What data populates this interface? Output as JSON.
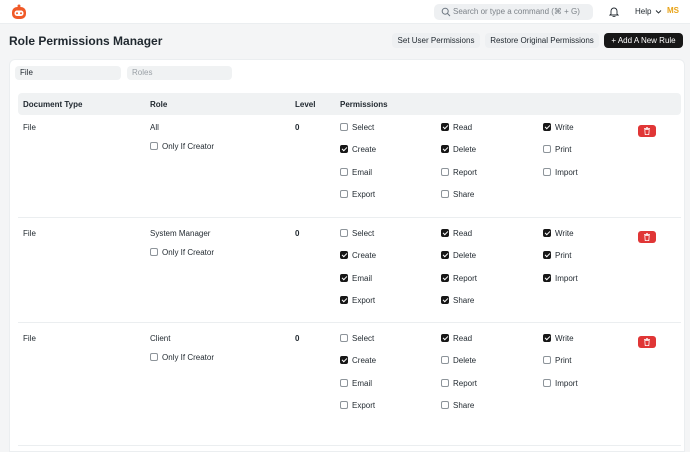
{
  "navbar": {
    "search_placeholder": "Search or type a command (⌘ + G)",
    "help_label": "Help",
    "avatar_initials": "MS"
  },
  "page": {
    "title": "Role Permissions Manager",
    "set_user_permissions": "Set User Permissions",
    "restore_original_permissions": "Restore Original Permissions",
    "add_new_rule": "+ Add A New Rule"
  },
  "filters": {
    "document_type_value": "File",
    "roles_placeholder": "Roles"
  },
  "table": {
    "headers": {
      "document_type": "Document Type",
      "role": "Role",
      "level": "Level",
      "permissions": "Permissions"
    },
    "only_if_creator_label": "Only If Creator",
    "rows": [
      {
        "document_type": "File",
        "role": "All",
        "level": "0",
        "only_if_creator": false,
        "permissions": [
          {
            "label": "Select",
            "checked": false
          },
          {
            "label": "Read",
            "checked": true
          },
          {
            "label": "Write",
            "checked": true
          },
          {
            "label": "Create",
            "checked": true
          },
          {
            "label": "Delete",
            "checked": true
          },
          {
            "label": "Print",
            "checked": false
          },
          {
            "label": "Email",
            "checked": false
          },
          {
            "label": "Report",
            "checked": false
          },
          {
            "label": "Import",
            "checked": false
          },
          {
            "label": "Export",
            "checked": false
          },
          {
            "label": "Share",
            "checked": false
          }
        ]
      },
      {
        "document_type": "File",
        "role": "System Manager",
        "level": "0",
        "only_if_creator": false,
        "permissions": [
          {
            "label": "Select",
            "checked": false
          },
          {
            "label": "Read",
            "checked": true
          },
          {
            "label": "Write",
            "checked": true
          },
          {
            "label": "Create",
            "checked": true
          },
          {
            "label": "Delete",
            "checked": true
          },
          {
            "label": "Print",
            "checked": true
          },
          {
            "label": "Email",
            "checked": true
          },
          {
            "label": "Report",
            "checked": true
          },
          {
            "label": "Import",
            "checked": true
          },
          {
            "label": "Export",
            "checked": true
          },
          {
            "label": "Share",
            "checked": true
          }
        ]
      },
      {
        "document_type": "File",
        "role": "Client",
        "level": "0",
        "only_if_creator": false,
        "permissions": [
          {
            "label": "Select",
            "checked": false
          },
          {
            "label": "Read",
            "checked": true
          },
          {
            "label": "Write",
            "checked": true
          },
          {
            "label": "Create",
            "checked": true
          },
          {
            "label": "Delete",
            "checked": false
          },
          {
            "label": "Print",
            "checked": false
          },
          {
            "label": "Email",
            "checked": false
          },
          {
            "label": "Report",
            "checked": false
          },
          {
            "label": "Import",
            "checked": false
          },
          {
            "label": "Export",
            "checked": false
          },
          {
            "label": "Share",
            "checked": false
          }
        ]
      }
    ]
  },
  "colors": {
    "accent_dark": "#171717",
    "delete_red": "#e03636",
    "avatar_yellow": "#e8a317",
    "logo_orange": "#f05a28"
  },
  "icons": [
    "app-logo-icon",
    "search-icon",
    "bell-icon",
    "chevron-down-icon",
    "trash-icon"
  ]
}
